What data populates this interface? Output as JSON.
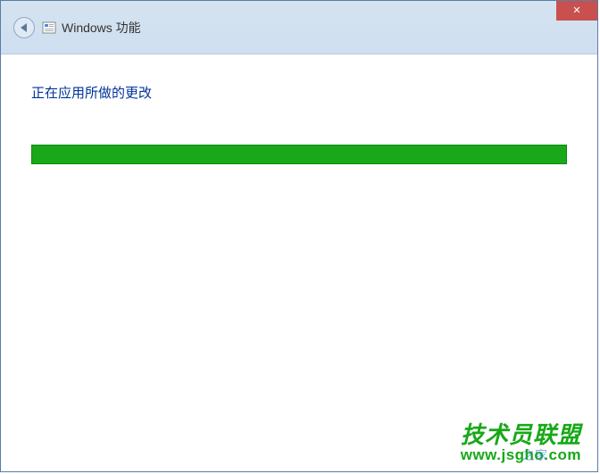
{
  "titlebar": {
    "title": "Windows 功能"
  },
  "content": {
    "status_text": "正在应用所做的更改",
    "progress_percent": 100
  },
  "watermark": {
    "text_cn": "技术员联盟",
    "url": "www.jsgho.com",
    "overlay_text": "之家"
  },
  "colors": {
    "titlebar_bg": "#d5e3f0",
    "close_bg": "#c8504f",
    "progress_fill": "#19a819",
    "status_text": "#003399",
    "watermark": "#18a818"
  }
}
